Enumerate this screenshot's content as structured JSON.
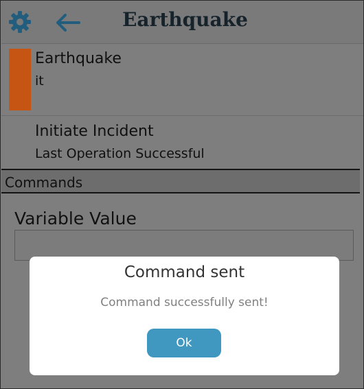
{
  "header": {
    "title": "Earthquake",
    "settings_icon": "gear-icon",
    "back_icon": "arrow-left-icon"
  },
  "incident": {
    "name": "Earthquake",
    "subtitle": "it",
    "status_color": "#c65412"
  },
  "operation": {
    "label": "Initiate Incident",
    "status": "Last Operation Successful"
  },
  "commands": {
    "section_label": "Commands",
    "variable_label": "Variable Value",
    "variable_value": ""
  },
  "dialog": {
    "title": "Command sent",
    "message": "Command successfully sent!",
    "ok_label": "Ok"
  },
  "colors": {
    "accent": "#4097c0",
    "header_icon": "#235d7d",
    "status_bar": "#c65412"
  }
}
